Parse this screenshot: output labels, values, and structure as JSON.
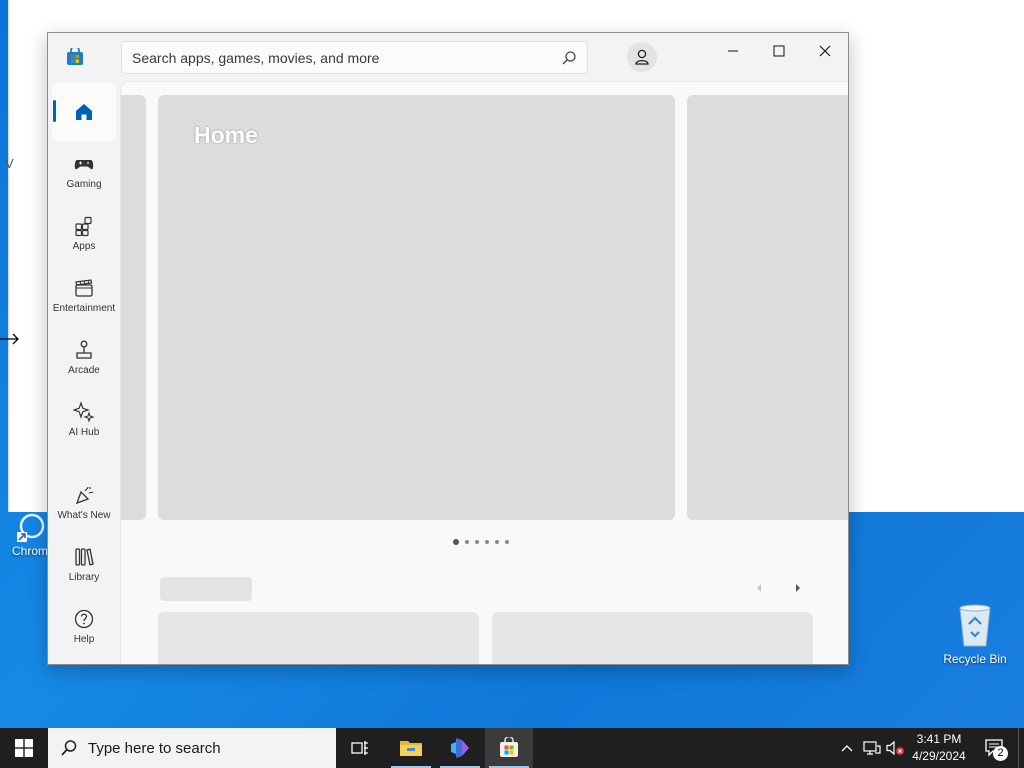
{
  "desktop": {
    "icons": [
      {
        "label": "Chrom"
      },
      {
        "label": "Recycle Bin"
      }
    ]
  },
  "background_window": {
    "glyph": "V"
  },
  "store": {
    "search_placeholder": "Search apps, games, movies, and more",
    "nav": [
      {
        "label": "Home",
        "icon": "home-icon"
      },
      {
        "label": "Gaming",
        "icon": "gamepad-icon"
      },
      {
        "label": "Apps",
        "icon": "apps-icon"
      },
      {
        "label": "Entertainment",
        "icon": "clapperboard-icon"
      },
      {
        "label": "Arcade",
        "icon": "joystick-icon"
      },
      {
        "label": "AI Hub",
        "icon": "sparkle-icon"
      },
      {
        "label": "What's New",
        "icon": "party-icon"
      },
      {
        "label": "Library",
        "icon": "library-icon"
      },
      {
        "label": "Help",
        "icon": "help-icon"
      }
    ],
    "hero_title": "Home",
    "carousel_pages": 6,
    "carousel_active": 1
  },
  "taskbar": {
    "search_placeholder": "Type here to search",
    "time": "3:41 PM",
    "date": "4/29/2024",
    "notification_count": "2"
  },
  "colors": {
    "accent": "#005fb8",
    "desktop_blue": "#0f78d9",
    "taskbar": "#1f1f1f"
  }
}
